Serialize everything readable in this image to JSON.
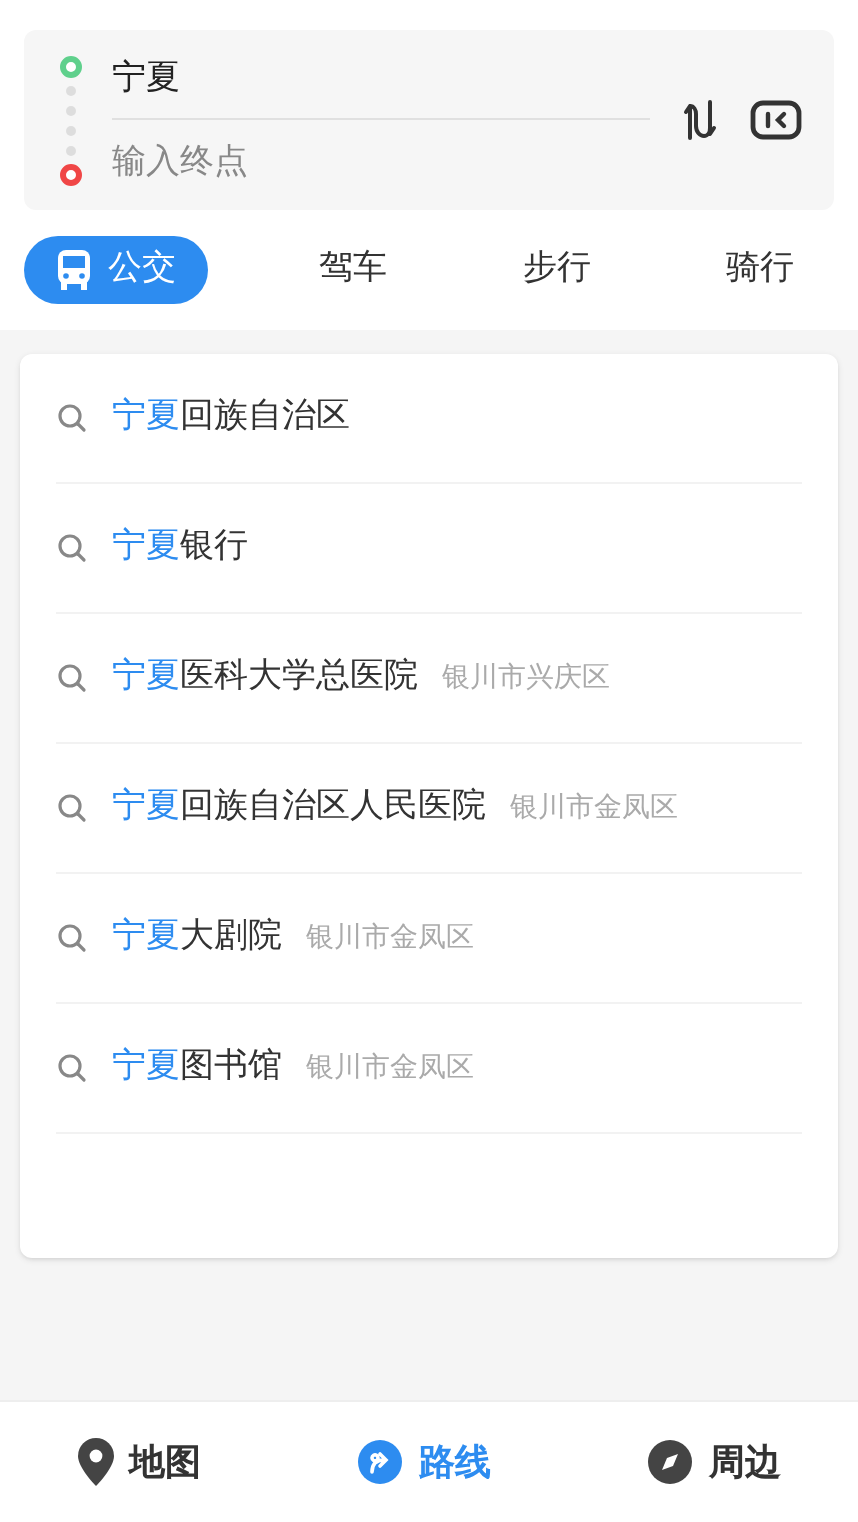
{
  "route_input": {
    "start": {
      "value": "宁夏"
    },
    "end": {
      "placeholder": "输入终点"
    }
  },
  "modes": [
    {
      "label": "公交",
      "selected": true
    },
    {
      "label": "驾车",
      "selected": false
    },
    {
      "label": "步行",
      "selected": false
    },
    {
      "label": "骑行",
      "selected": false
    }
  ],
  "suggestions": [
    {
      "match": "宁夏",
      "rest": "回族自治区"
    },
    {
      "match": "宁夏",
      "rest": "银行"
    },
    {
      "match": "宁夏",
      "rest": "医科大学总医院",
      "district": "银川市兴庆区"
    },
    {
      "match": "宁夏",
      "rest": "回族自治区人民医院",
      "district": "银川市金凤区"
    },
    {
      "match": "宁夏",
      "rest": "大剧院",
      "district": "银川市金凤区"
    },
    {
      "match": "宁夏",
      "rest": "图书馆",
      "district": "银川市金凤区"
    }
  ],
  "bottom_nav": [
    {
      "label": "地图",
      "kind": "pin",
      "selected": false
    },
    {
      "label": "路线",
      "kind": "route",
      "selected": true
    },
    {
      "label": "周边",
      "kind": "compass",
      "selected": false
    }
  ]
}
